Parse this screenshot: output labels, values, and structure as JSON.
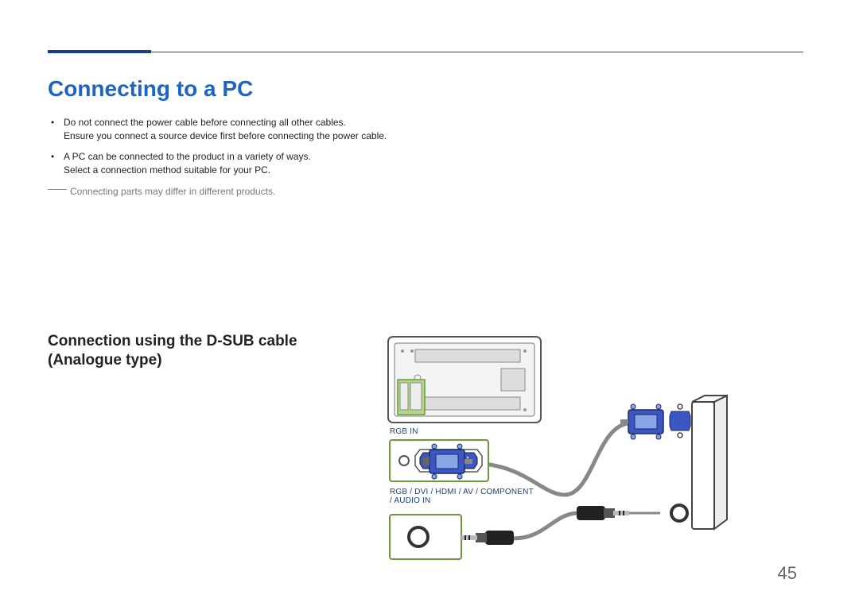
{
  "page": {
    "title": "Connecting to a PC",
    "bullets": [
      {
        "line1": "Do not connect the power cable before connecting all other cables.",
        "line2": "Ensure you connect a source device first before connecting the power cable."
      },
      {
        "line1": "A PC can be connected to the product in a variety of ways.",
        "line2": "Select a connection method suitable for your PC."
      }
    ],
    "note": "Connecting parts may differ in different products.",
    "h2_line1": "Connection using the D-SUB cable",
    "h2_line2": "(Analogue type)",
    "labels": {
      "rgb_in": "RGB IN",
      "audio_in_line1": "RGB / DVI / HDMI / AV / COMPONENT",
      "audio_in_line2": "/ AUDIO IN"
    },
    "page_number": "45"
  }
}
